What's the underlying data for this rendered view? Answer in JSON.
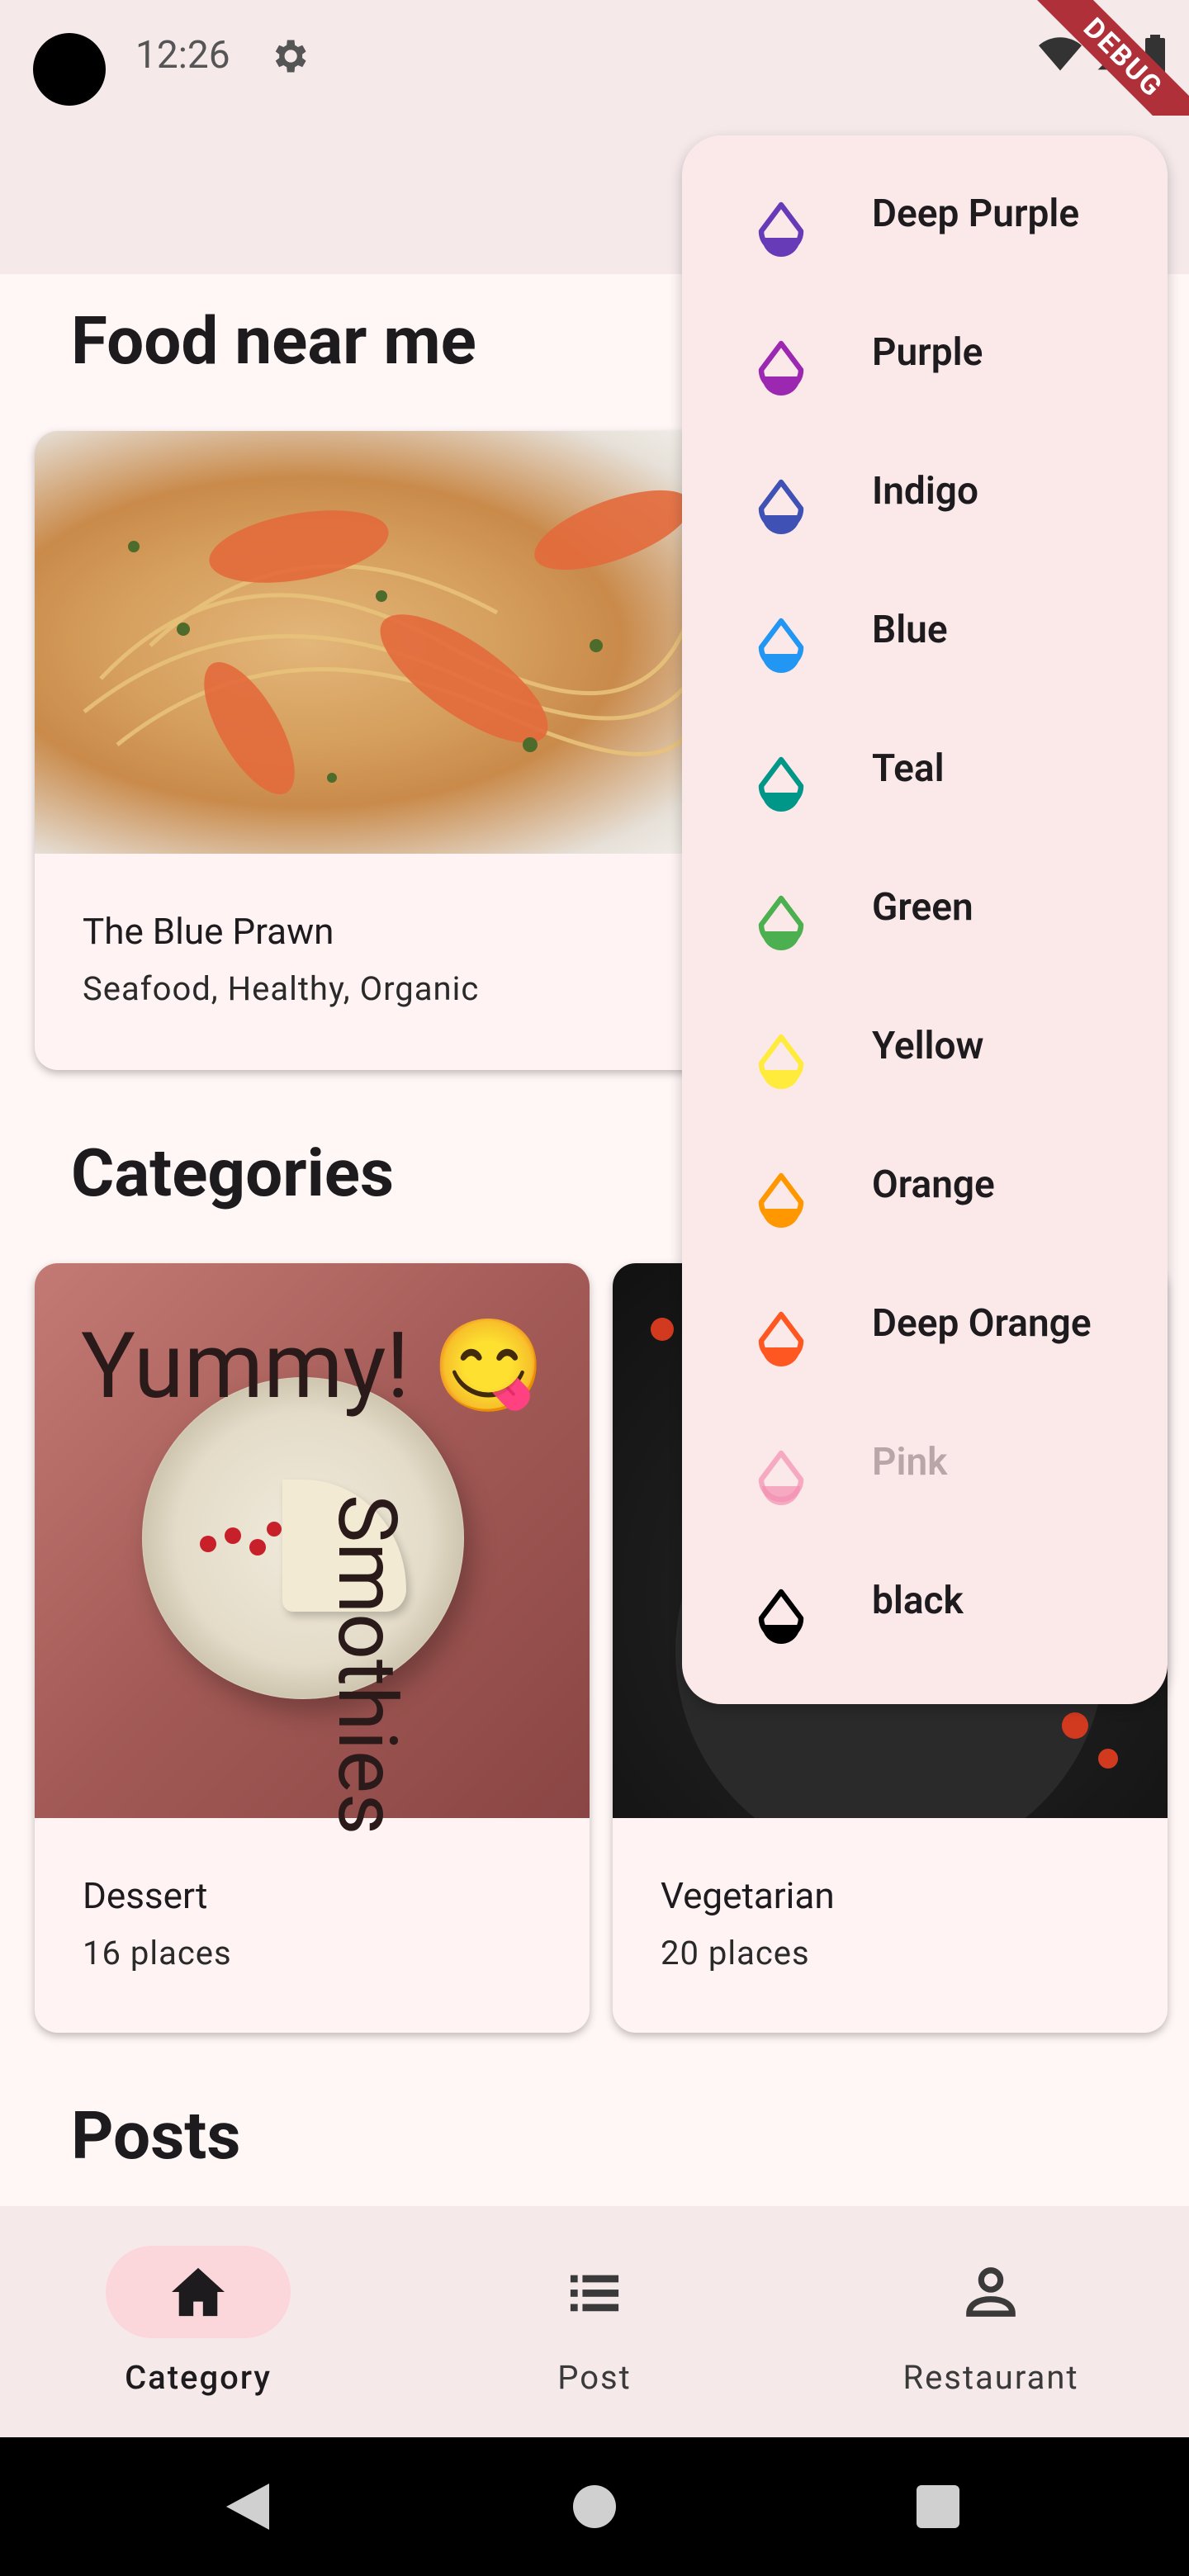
{
  "status_bar": {
    "time": "12:26",
    "debug_label": "DEBUG"
  },
  "sections": {
    "food_near_me": "Food near me",
    "categories": "Categories",
    "posts": "Posts"
  },
  "restaurant_card": {
    "name": "The Blue Prawn",
    "tags": "Seafood, Healthy, Organic"
  },
  "category_cards": [
    {
      "name": "Dessert",
      "count": "16 places",
      "overlay_text_1": "Yummy! 😋",
      "overlay_text_2": "Smothies"
    },
    {
      "name": "Vegetarian",
      "count": "20 places"
    }
  ],
  "color_menu": {
    "items": [
      {
        "label": "Deep Purple",
        "color": "#673ab7",
        "enabled": true
      },
      {
        "label": "Purple",
        "color": "#9c27b0",
        "enabled": true
      },
      {
        "label": "Indigo",
        "color": "#3f51b5",
        "enabled": true
      },
      {
        "label": "Blue",
        "color": "#2196f3",
        "enabled": true
      },
      {
        "label": "Teal",
        "color": "#009688",
        "enabled": true
      },
      {
        "label": "Green",
        "color": "#4caf50",
        "enabled": true
      },
      {
        "label": "Yellow",
        "color": "#ffeb3b",
        "enabled": true
      },
      {
        "label": "Orange",
        "color": "#ff9800",
        "enabled": true
      },
      {
        "label": "Deep Orange",
        "color": "#ff5722",
        "enabled": true
      },
      {
        "label": "Pink",
        "color": "#f48fb1",
        "enabled": false
      },
      {
        "label": "black",
        "color": "#000000",
        "enabled": true
      }
    ]
  },
  "bottom_nav": {
    "items": [
      {
        "label": "Category",
        "icon": "home-icon",
        "active": true
      },
      {
        "label": "Post",
        "icon": "list-icon",
        "active": false
      },
      {
        "label": "Restaurant",
        "icon": "person-icon",
        "active": false
      }
    ]
  }
}
